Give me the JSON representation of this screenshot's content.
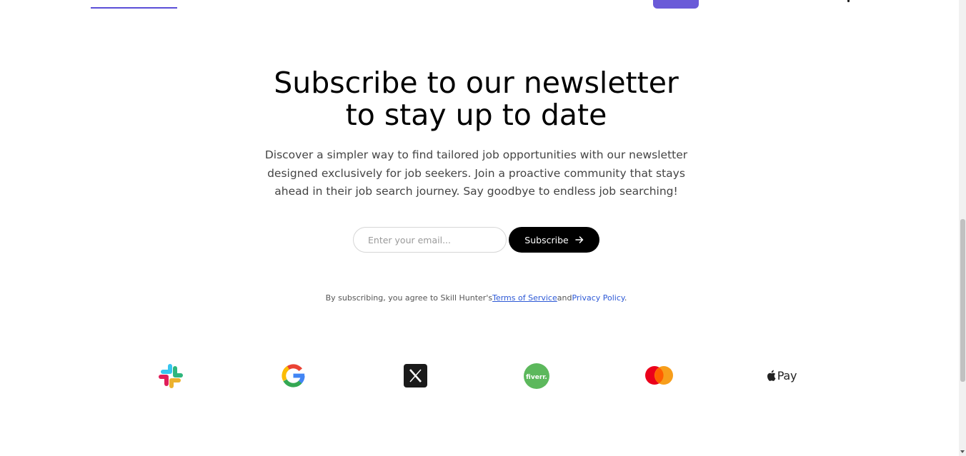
{
  "newsletter": {
    "headline_line1": "Subscribe to our newsletter",
    "headline_line2": "to stay up to date",
    "intro": "Discover a simpler way to find tailored job opportunities with our newsletter designed exclusively for job seekers. Join a proactive community that stays ahead in their job search journey. Say goodbye to endless job searching!",
    "email_placeholder": "Enter your email...",
    "subscribe_label": "Subscribe",
    "legal_prefix": "By subscribing, you agree to Skill Hunter's",
    "terms_link": "Terms of Service",
    "legal_and": "and",
    "privacy_link": "Privacy Policy",
    "legal_suffix": "."
  },
  "partner_logos": [
    {
      "name": "Slack",
      "icon": "slack-icon"
    },
    {
      "name": "Google",
      "icon": "google-icon"
    },
    {
      "name": "X",
      "icon": "x-icon"
    },
    {
      "name": "Fiverr",
      "icon": "fiverr-icon",
      "text": "fiverr."
    },
    {
      "name": "Mastercard",
      "icon": "mastercard-icon"
    },
    {
      "name": "Apple Pay",
      "icon": "apple-pay-icon",
      "text": "Pay"
    }
  ],
  "colors": {
    "accent": "#6a5ad8",
    "button_bg": "#000000",
    "link": "#2d59d6",
    "body_text": "#444444"
  }
}
